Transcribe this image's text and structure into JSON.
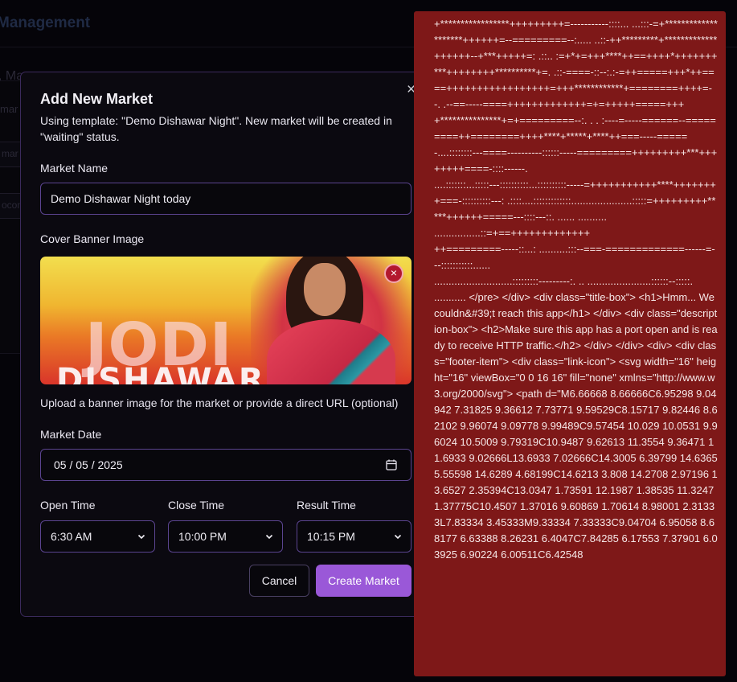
{
  "background": {
    "title": "Management",
    "subtitle": ", Ma",
    "ghost_labels": [
      "mar",
      "mar",
      "ocon"
    ]
  },
  "modal": {
    "title": "Add New Market",
    "description": "Using template: \"Demo Dishawar Night\". New market will be created in \"waiting\" status.",
    "close_icon": "×",
    "market_name": {
      "label": "Market Name",
      "value": "Demo Dishawar Night today"
    },
    "cover_banner": {
      "label": "Cover Banner Image",
      "banner_text_line1": "JODI",
      "banner_text_line2": "DISHAWAR",
      "remove_icon": "×",
      "help": "Upload a banner image for the market or provide a direct URL (optional)"
    },
    "market_date": {
      "label": "Market Date",
      "value": "05 / 05 / 2025"
    },
    "open_time": {
      "label": "Open Time",
      "value": "6:30 AM"
    },
    "close_time": {
      "label": "Close Time",
      "value": "10:00 PM"
    },
    "result_time": {
      "label": "Result Time",
      "value": "10:15 PM"
    },
    "cancel_label": "Cancel",
    "create_label": "Create Market"
  },
  "error_pane": {
    "text": "+*****************+++++++++=-----------::::... ...:::-=+********************++++++=--=========--:..... ..::-++*********+*************++++++--+***+++++=: .::.. :=+*+=+++****++==++++*+++++++***++++++++**********+=. .::-====-::--:.:-=++=====+++*++====+++++++++++++++++=+++************+========++++=--. .--==-----====+++++++++++++=+=+++++=====+++\n+***************+=+=========--:. . . :----=-----======--=========++========++++****+*****+****++===-----=====-....::::::::---====----------::::::-----=========+++++++++***++++++++====-::::------.\n....:::::::...:::::---::::::::::...::::::::::-----=+++++++++++****++++++++===-::::::::::---: .::::....:::::::::::::.....................:::::=+++++++++*****++++++=====---::::---::. ...... ..........\n................::=+==+++++++++++++\n++=========-----::...: ..........:::--===-=============------=---:::::::::::......\n...........................:::::::::---------:. .. ......................::::::--:::::. ........... </pre> </div> <div class=\"title-box\"> <h1>Hmm... We couldn&#39;t reach this app</h1> </div> <div class=\"description-box\"> <h2>Make sure this app has a port open and is ready to receive HTTP traffic.</h2> </div> </div> <div> <div class=\"footer-item\"> <div class=\"link-icon\"> <svg width=\"16\" height=\"16\" viewBox=\"0 0 16 16\" fill=\"none\" xmlns=\"http://www.w3.org/2000/svg\"> <path d=\"M6.66668 8.66666C6.95298 9.04942 7.31825 9.36612 7.73771 9.59529C8.15717 9.82446 8.62102 9.96074 9.09778 9.99489C9.57454 10.029 10.0531 9.96024 10.5009 9.79319C10.9487 9.62613 11.3554 9.36471 11.6933 9.02666L13.6933 7.02666C14.3005 6.39799 14.6365 5.55598 14.6289 4.68199C14.6213 3.808 14.2708 2.97196 13.6527 2.35394C13.0347 1.73591 12.1987 1.38535 11.3247 1.37775C10.4507 1.37016 9.60869 1.70614 8.98001 2.31333L7.83334 3.45333M9.33334 7.33333C9.04704 6.95058 8.68177 6.63388 8.26231 6.4047C7.84285 6.17553 7.37901 6.03925 6.90224 6.00511C6.42548"
  }
}
